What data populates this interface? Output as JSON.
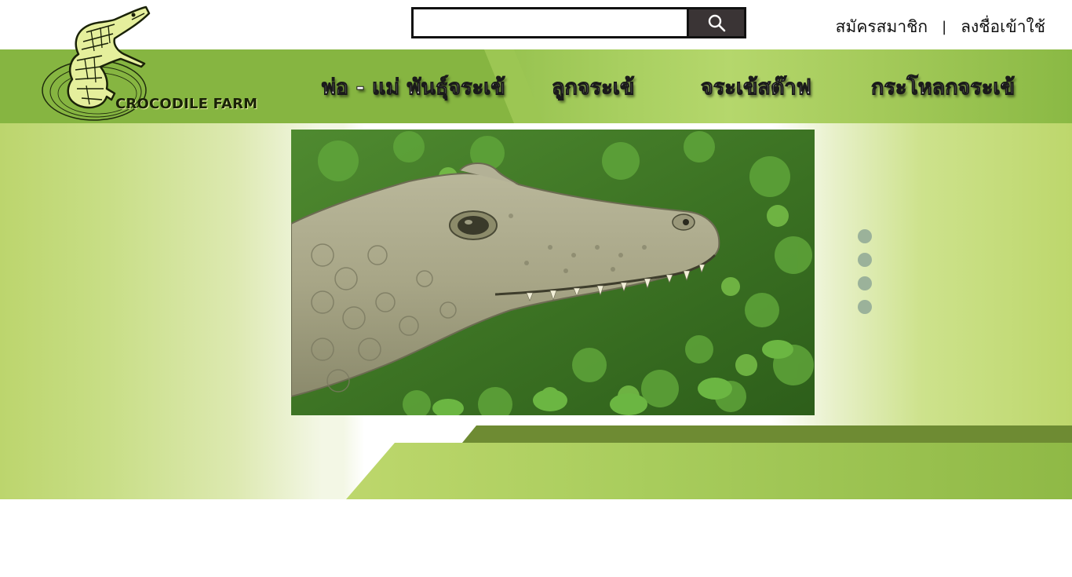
{
  "logo": {
    "text": "CROCODILE FARM"
  },
  "search": {
    "placeholder": "",
    "value": "",
    "icon": "search-icon"
  },
  "auth": {
    "register": "สมัครสมาชิก",
    "separator": "|",
    "login": "ลงชื่อเข้าใช้"
  },
  "nav": {
    "items": [
      {
        "label": "พ่อ - แม่ พันธุ์จระเข้"
      },
      {
        "label": "ลูกจระเข้"
      },
      {
        "label": "จระเข้สต๊าฟ"
      },
      {
        "label": "กระโหลกจระเข้"
      }
    ]
  },
  "carousel": {
    "slide_count": 4,
    "active_index": 0
  },
  "colors": {
    "nav_green": "#8cba45",
    "hero_green": "#bdd76c",
    "band_dark": "#6e8b33",
    "search_button": "#3a3435",
    "dot": "#9bb29a"
  }
}
